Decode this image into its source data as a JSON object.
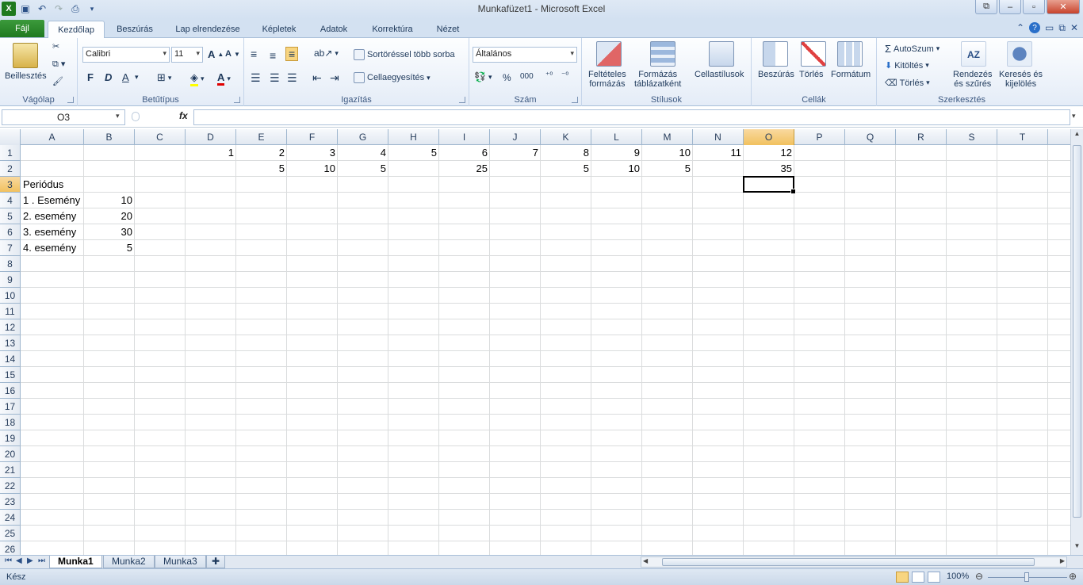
{
  "window": {
    "title": "Munkafüzet1  -  Microsoft Excel"
  },
  "tabs": [
    {
      "label": "Fájl",
      "active": false
    },
    {
      "label": "Kezdőlap",
      "active": true
    },
    {
      "label": "Beszúrás",
      "active": false
    },
    {
      "label": "Lap elrendezése",
      "active": false
    },
    {
      "label": "Képletek",
      "active": false
    },
    {
      "label": "Adatok",
      "active": false
    },
    {
      "label": "Korrektúra",
      "active": false
    },
    {
      "label": "Nézet",
      "active": false
    }
  ],
  "ribbon": {
    "clipboard": {
      "label": "Vágólap",
      "paste": "Beillesztés"
    },
    "font": {
      "label": "Betűtípus",
      "name": "Calibri",
      "size": "11",
      "bold": "F",
      "italic": "D",
      "underline": "A"
    },
    "alignment": {
      "label": "Igazítás",
      "wrap": "Sortöréssel több sorba",
      "merge": "Cellaegyesítés"
    },
    "number": {
      "label": "Szám",
      "format": "Általános",
      "percent": "%",
      "thousands": "000"
    },
    "styles": {
      "label": "Stílusok",
      "conditional_1": "Feltételes",
      "conditional_2": "formázás",
      "table_1": "Formázás",
      "table_2": "táblázatként",
      "cellstyles": "Cellastílusok"
    },
    "cells": {
      "label": "Cellák",
      "insert": "Beszúrás",
      "delete": "Törlés",
      "format": "Formátum"
    },
    "editing": {
      "label": "Szerkesztés",
      "autosum": "AutoSzum",
      "fill": "Kitöltés",
      "clear": "Törlés",
      "sort_1": "Rendezés",
      "sort_2": "és szűrés",
      "find_1": "Keresés és",
      "find_2": "kijelölés"
    }
  },
  "formula_bar": {
    "name_box": "O3",
    "fx": "fx",
    "value": ""
  },
  "grid": {
    "columns": [
      "A",
      "B",
      "C",
      "D",
      "E",
      "F",
      "G",
      "H",
      "I",
      "J",
      "K",
      "L",
      "M",
      "N",
      "O",
      "P",
      "Q",
      "R",
      "S",
      "T"
    ],
    "rows": [
      "1",
      "2",
      "3",
      "4",
      "5",
      "6",
      "7",
      "8",
      "9",
      "10",
      "11",
      "12",
      "13",
      "14",
      "15",
      "16",
      "17",
      "18",
      "19",
      "20",
      "21",
      "22",
      "23",
      "24",
      "25",
      "26"
    ],
    "selected": "O3",
    "cells": [
      {
        "ref": "D1",
        "value": "1",
        "num": true
      },
      {
        "ref": "E1",
        "value": "2",
        "num": true
      },
      {
        "ref": "F1",
        "value": "3",
        "num": true
      },
      {
        "ref": "G1",
        "value": "4",
        "num": true
      },
      {
        "ref": "H1",
        "value": "5",
        "num": true
      },
      {
        "ref": "I1",
        "value": "6",
        "num": true
      },
      {
        "ref": "J1",
        "value": "7",
        "num": true
      },
      {
        "ref": "K1",
        "value": "8",
        "num": true
      },
      {
        "ref": "L1",
        "value": "9",
        "num": true
      },
      {
        "ref": "M1",
        "value": "10",
        "num": true
      },
      {
        "ref": "N1",
        "value": "11",
        "num": true
      },
      {
        "ref": "O1",
        "value": "12",
        "num": true
      },
      {
        "ref": "E2",
        "value": "5",
        "num": true
      },
      {
        "ref": "F2",
        "value": "10",
        "num": true
      },
      {
        "ref": "G2",
        "value": "5",
        "num": true
      },
      {
        "ref": "I2",
        "value": "25",
        "num": true
      },
      {
        "ref": "K2",
        "value": "5",
        "num": true
      },
      {
        "ref": "L2",
        "value": "10",
        "num": true
      },
      {
        "ref": "M2",
        "value": "5",
        "num": true
      },
      {
        "ref": "O2",
        "value": "35",
        "num": true
      },
      {
        "ref": "A3",
        "value": "Periódus",
        "num": false
      },
      {
        "ref": "A4",
        "value": "1 . Esemény",
        "num": false
      },
      {
        "ref": "B4",
        "value": "10",
        "num": true
      },
      {
        "ref": "A5",
        "value": "2. esemény",
        "num": false
      },
      {
        "ref": "B5",
        "value": "20",
        "num": true
      },
      {
        "ref": "A6",
        "value": "3. esemény",
        "num": false
      },
      {
        "ref": "B6",
        "value": "30",
        "num": true
      },
      {
        "ref": "A7",
        "value": "4. esemény",
        "num": false
      },
      {
        "ref": "B7",
        "value": "5",
        "num": true
      }
    ]
  },
  "sheets": [
    {
      "label": "Munka1",
      "active": true
    },
    {
      "label": "Munka2",
      "active": false
    },
    {
      "label": "Munka3",
      "active": false
    }
  ],
  "status": {
    "text": "Kész",
    "zoom": "100%"
  },
  "colors": {
    "file_tab": "#1f7a1f",
    "selected_header": "#f1c15f",
    "gridline": "#dadcdd"
  }
}
